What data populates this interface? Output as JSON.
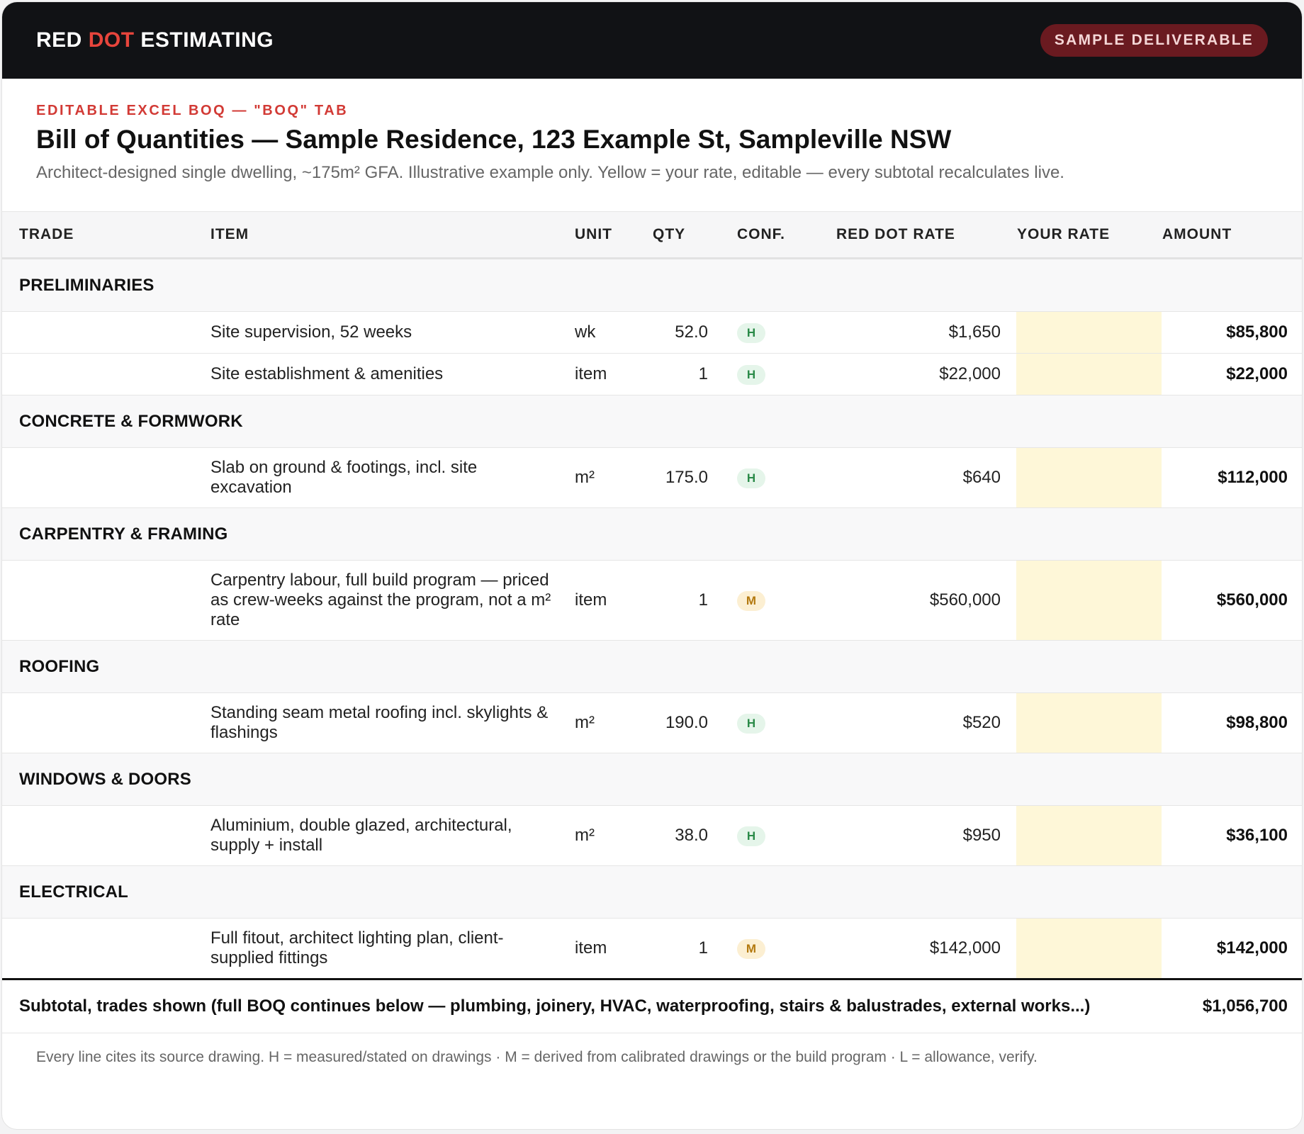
{
  "header": {
    "brand_prefix": "RED ",
    "brand_accent": "DOT",
    "brand_suffix": " ESTIMATING",
    "badge": "SAMPLE DELIVERABLE"
  },
  "doc": {
    "kicker": "EDITABLE EXCEL BOQ — \"BOQ\" TAB",
    "title": "Bill of Quantities — Sample Residence, 123 Example St, Sampleville NSW",
    "subtitle": "Architect-designed single dwelling, ~175m² GFA. Illustrative example only. Yellow = your rate, editable — every subtotal recalculates live."
  },
  "table": {
    "columns": {
      "trade": "TRADE",
      "item": "ITEM",
      "unit": "UNIT",
      "qty": "QTY",
      "conf": "CONF.",
      "red_dot_rate": "RED DOT RATE",
      "your_rate": "YOUR RATE",
      "amount": "AMOUNT"
    },
    "groups": [
      {
        "trade": "PRELIMINARIES",
        "lines": [
          {
            "item": "Site supervision, 52 weeks",
            "unit": "wk",
            "qty": "52.0",
            "conf": "H",
            "rate": "$1,650",
            "your_rate": "",
            "amount": "$85,800"
          },
          {
            "item": "Site establishment & amenities",
            "unit": "item",
            "qty": "1",
            "conf": "H",
            "rate": "$22,000",
            "your_rate": "",
            "amount": "$22,000"
          }
        ]
      },
      {
        "trade": "CONCRETE & FORMWORK",
        "lines": [
          {
            "item": "Slab on ground & footings, incl. site excavation",
            "unit": "m²",
            "qty": "175.0",
            "conf": "H",
            "rate": "$640",
            "your_rate": "",
            "amount": "$112,000"
          }
        ]
      },
      {
        "trade": "CARPENTRY & FRAMING",
        "lines": [
          {
            "item": "Carpentry labour, full build program — priced as crew-weeks against the program, not a m² rate",
            "unit": "item",
            "qty": "1",
            "conf": "M",
            "rate": "$560,000",
            "your_rate": "",
            "amount": "$560,000"
          }
        ]
      },
      {
        "trade": "ROOFING",
        "lines": [
          {
            "item": "Standing seam metal roofing incl. skylights & flashings",
            "unit": "m²",
            "qty": "190.0",
            "conf": "H",
            "rate": "$520",
            "your_rate": "",
            "amount": "$98,800"
          }
        ]
      },
      {
        "trade": "WINDOWS & DOORS",
        "lines": [
          {
            "item": "Aluminium, double glazed, architectural, supply + install",
            "unit": "m²",
            "qty": "38.0",
            "conf": "H",
            "rate": "$950",
            "your_rate": "",
            "amount": "$36,100"
          }
        ]
      },
      {
        "trade": "ELECTRICAL",
        "lines": [
          {
            "item": "Full fitout, architect lighting plan, client-supplied fittings",
            "unit": "item",
            "qty": "1",
            "conf": "M",
            "rate": "$142,000",
            "your_rate": "",
            "amount": "$142,000"
          }
        ]
      }
    ],
    "subtotal_label": "Subtotal, trades shown (full BOQ continues below — plumbing, joinery, HVAC, waterproofing, stairs & balustrades, external works...)",
    "subtotal_amount": "$1,056,700"
  },
  "footer": {
    "note": "Every line cites its source drawing. H = measured/stated on drawings · M = derived from calibrated drawings or the build program · L = allowance, verify."
  },
  "colors": {
    "accent_red": "#e8453c",
    "your_rate_fill": "#fef7d8",
    "conf_h": "#2a8a48",
    "conf_m": "#b3790f"
  }
}
